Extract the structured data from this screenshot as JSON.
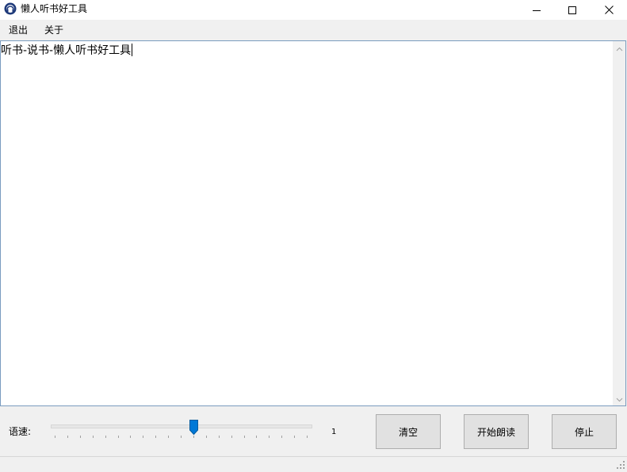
{
  "window": {
    "title": "懒人听书好工具",
    "icon": "headphones-logo-icon",
    "controls": [
      "minimize-icon",
      "maximize-icon",
      "close-icon"
    ]
  },
  "menu": {
    "exit_label": "退出",
    "about_label": "关于"
  },
  "editor": {
    "text": "听书-说书-懒人听书好工具"
  },
  "speed": {
    "label": "语速:",
    "value": "1",
    "slider_fraction": 0.55
  },
  "buttons": {
    "clear_label": "清空",
    "start_label": "开始朗读",
    "stop_label": "停止"
  },
  "colors": {
    "slider_thumb": "#0078d7",
    "textarea_border": "#7a9cbf"
  }
}
